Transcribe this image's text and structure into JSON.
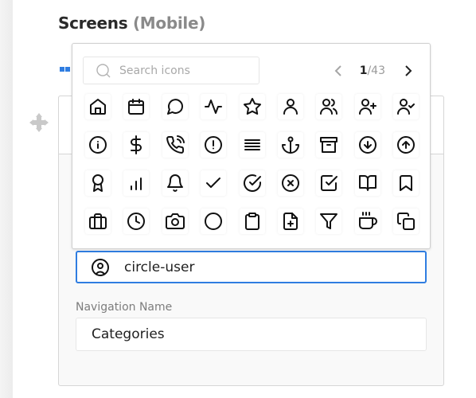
{
  "section": {
    "title": "Screens",
    "subtitle": "(Mobile)"
  },
  "colors": {
    "accent": "#2f7de1",
    "text": "#1f1f1f",
    "muted": "#8a8a8a"
  },
  "icon_picker": {
    "search_placeholder": "Search icons",
    "pagination": {
      "current": "1",
      "separator": "/",
      "total": "43"
    },
    "icons": [
      "house",
      "calendar",
      "message-circle",
      "activity",
      "star",
      "user",
      "users",
      "user-plus",
      "user-check",
      "info",
      "dollar-sign",
      "phone-call",
      "alert-circle",
      "align-justify",
      "anchor",
      "archive",
      "arrow-down-circle",
      "arrow-up-circle",
      "award",
      "bar-chart",
      "bell",
      "check",
      "check-circle",
      "x-circle",
      "check-square",
      "book-open",
      "bookmark",
      "briefcase",
      "clock",
      "camera",
      "circle",
      "clipboard",
      "file-plus",
      "filter",
      "coffee",
      "copy"
    ]
  },
  "icon_field": {
    "icon": "circle-user",
    "value": "circle-user"
  },
  "navigation_name": {
    "label": "Navigation Name",
    "value": "Categories"
  }
}
